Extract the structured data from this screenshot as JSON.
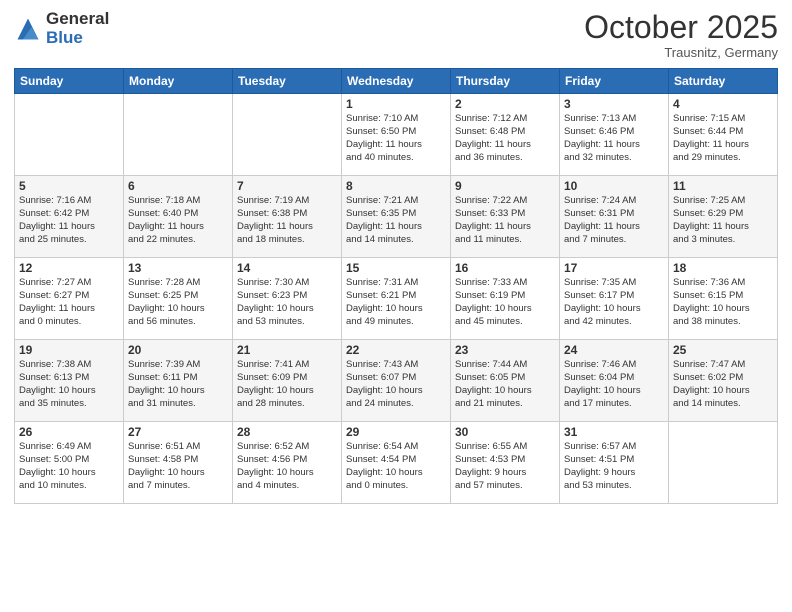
{
  "header": {
    "logo_general": "General",
    "logo_blue": "Blue",
    "month": "October 2025",
    "location": "Trausnitz, Germany"
  },
  "days_of_week": [
    "Sunday",
    "Monday",
    "Tuesday",
    "Wednesday",
    "Thursday",
    "Friday",
    "Saturday"
  ],
  "weeks": [
    [
      {
        "day": "",
        "info": ""
      },
      {
        "day": "",
        "info": ""
      },
      {
        "day": "",
        "info": ""
      },
      {
        "day": "1",
        "info": "Sunrise: 7:10 AM\nSunset: 6:50 PM\nDaylight: 11 hours\nand 40 minutes."
      },
      {
        "day": "2",
        "info": "Sunrise: 7:12 AM\nSunset: 6:48 PM\nDaylight: 11 hours\nand 36 minutes."
      },
      {
        "day": "3",
        "info": "Sunrise: 7:13 AM\nSunset: 6:46 PM\nDaylight: 11 hours\nand 32 minutes."
      },
      {
        "day": "4",
        "info": "Sunrise: 7:15 AM\nSunset: 6:44 PM\nDaylight: 11 hours\nand 29 minutes."
      }
    ],
    [
      {
        "day": "5",
        "info": "Sunrise: 7:16 AM\nSunset: 6:42 PM\nDaylight: 11 hours\nand 25 minutes."
      },
      {
        "day": "6",
        "info": "Sunrise: 7:18 AM\nSunset: 6:40 PM\nDaylight: 11 hours\nand 22 minutes."
      },
      {
        "day": "7",
        "info": "Sunrise: 7:19 AM\nSunset: 6:38 PM\nDaylight: 11 hours\nand 18 minutes."
      },
      {
        "day": "8",
        "info": "Sunrise: 7:21 AM\nSunset: 6:35 PM\nDaylight: 11 hours\nand 14 minutes."
      },
      {
        "day": "9",
        "info": "Sunrise: 7:22 AM\nSunset: 6:33 PM\nDaylight: 11 hours\nand 11 minutes."
      },
      {
        "day": "10",
        "info": "Sunrise: 7:24 AM\nSunset: 6:31 PM\nDaylight: 11 hours\nand 7 minutes."
      },
      {
        "day": "11",
        "info": "Sunrise: 7:25 AM\nSunset: 6:29 PM\nDaylight: 11 hours\nand 3 minutes."
      }
    ],
    [
      {
        "day": "12",
        "info": "Sunrise: 7:27 AM\nSunset: 6:27 PM\nDaylight: 11 hours\nand 0 minutes."
      },
      {
        "day": "13",
        "info": "Sunrise: 7:28 AM\nSunset: 6:25 PM\nDaylight: 10 hours\nand 56 minutes."
      },
      {
        "day": "14",
        "info": "Sunrise: 7:30 AM\nSunset: 6:23 PM\nDaylight: 10 hours\nand 53 minutes."
      },
      {
        "day": "15",
        "info": "Sunrise: 7:31 AM\nSunset: 6:21 PM\nDaylight: 10 hours\nand 49 minutes."
      },
      {
        "day": "16",
        "info": "Sunrise: 7:33 AM\nSunset: 6:19 PM\nDaylight: 10 hours\nand 45 minutes."
      },
      {
        "day": "17",
        "info": "Sunrise: 7:35 AM\nSunset: 6:17 PM\nDaylight: 10 hours\nand 42 minutes."
      },
      {
        "day": "18",
        "info": "Sunrise: 7:36 AM\nSunset: 6:15 PM\nDaylight: 10 hours\nand 38 minutes."
      }
    ],
    [
      {
        "day": "19",
        "info": "Sunrise: 7:38 AM\nSunset: 6:13 PM\nDaylight: 10 hours\nand 35 minutes."
      },
      {
        "day": "20",
        "info": "Sunrise: 7:39 AM\nSunset: 6:11 PM\nDaylight: 10 hours\nand 31 minutes."
      },
      {
        "day": "21",
        "info": "Sunrise: 7:41 AM\nSunset: 6:09 PM\nDaylight: 10 hours\nand 28 minutes."
      },
      {
        "day": "22",
        "info": "Sunrise: 7:43 AM\nSunset: 6:07 PM\nDaylight: 10 hours\nand 24 minutes."
      },
      {
        "day": "23",
        "info": "Sunrise: 7:44 AM\nSunset: 6:05 PM\nDaylight: 10 hours\nand 21 minutes."
      },
      {
        "day": "24",
        "info": "Sunrise: 7:46 AM\nSunset: 6:04 PM\nDaylight: 10 hours\nand 17 minutes."
      },
      {
        "day": "25",
        "info": "Sunrise: 7:47 AM\nSunset: 6:02 PM\nDaylight: 10 hours\nand 14 minutes."
      }
    ],
    [
      {
        "day": "26",
        "info": "Sunrise: 6:49 AM\nSunset: 5:00 PM\nDaylight: 10 hours\nand 10 minutes."
      },
      {
        "day": "27",
        "info": "Sunrise: 6:51 AM\nSunset: 4:58 PM\nDaylight: 10 hours\nand 7 minutes."
      },
      {
        "day": "28",
        "info": "Sunrise: 6:52 AM\nSunset: 4:56 PM\nDaylight: 10 hours\nand 4 minutes."
      },
      {
        "day": "29",
        "info": "Sunrise: 6:54 AM\nSunset: 4:54 PM\nDaylight: 10 hours\nand 0 minutes."
      },
      {
        "day": "30",
        "info": "Sunrise: 6:55 AM\nSunset: 4:53 PM\nDaylight: 9 hours\nand 57 minutes."
      },
      {
        "day": "31",
        "info": "Sunrise: 6:57 AM\nSunset: 4:51 PM\nDaylight: 9 hours\nand 53 minutes."
      },
      {
        "day": "",
        "info": ""
      }
    ]
  ]
}
